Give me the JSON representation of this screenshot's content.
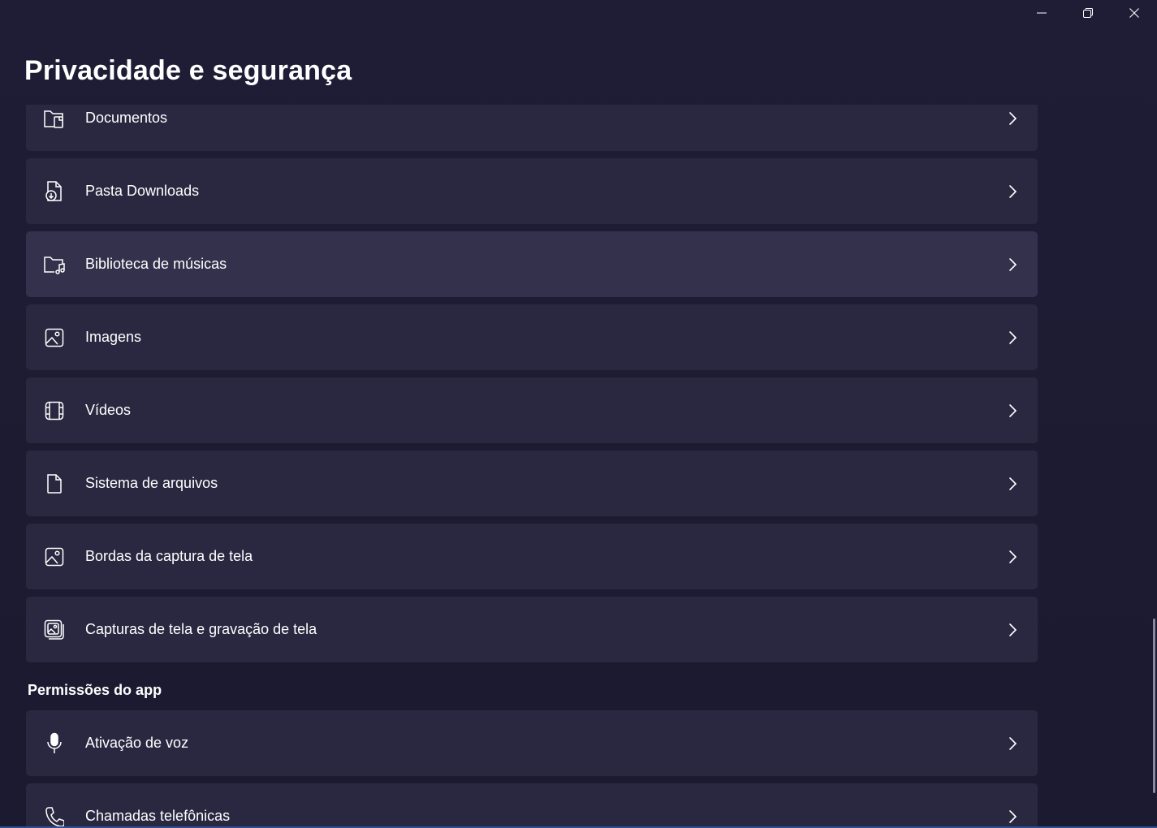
{
  "window": {
    "title": "Privacidade e segurança"
  },
  "caption": {
    "minimize_icon": "minimize-icon",
    "restore_icon": "restore-icon",
    "close_icon": "close-icon"
  },
  "items_top": [
    {
      "label": "Documentos",
      "icon": "documents-folder-icon"
    },
    {
      "label": "Pasta Downloads",
      "icon": "download-file-icon"
    },
    {
      "label": "Biblioteca de músicas",
      "icon": "music-folder-icon"
    },
    {
      "label": "Imagens",
      "icon": "image-icon"
    },
    {
      "label": "Vídeos",
      "icon": "video-film-icon"
    },
    {
      "label": "Sistema de arquivos",
      "icon": "file-icon"
    },
    {
      "label": "Bordas da captura de tela",
      "icon": "screenshot-border-icon"
    },
    {
      "label": "Capturas de tela e gravação de tela",
      "icon": "screenshots-icon"
    }
  ],
  "section_app_permissions": {
    "title": "Permissões do app"
  },
  "items_bottom": [
    {
      "label": "Ativação de voz",
      "icon": "microphone-icon"
    },
    {
      "label": "Chamadas telefônicas",
      "icon": "phone-icon"
    }
  ],
  "colors": {
    "background": "#1e1c33",
    "card": "#2a2841",
    "card_hover": "#33314b",
    "text": "#ffffff"
  }
}
